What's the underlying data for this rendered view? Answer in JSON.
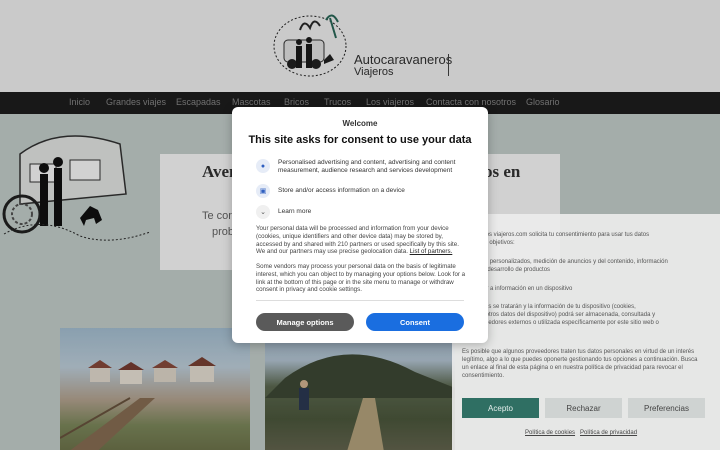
{
  "site": {
    "name": "Autocaravaneros",
    "tagline": "Viajeros"
  },
  "nav": {
    "items": [
      "Inicio",
      "Grandes viajes",
      "Escapadas",
      "Mascotas",
      "Bricos",
      "Trucos",
      "Los viajeros",
      "Contacta con nosotros",
      "Glosario"
    ]
  },
  "hero": {
    "title_start": "Aven",
    "title_end": "os en",
    "text_line1": "Te con",
    "text_line2": "prob"
  },
  "consent_dialog": {
    "welcome": "Welcome",
    "title": "This site asks for consent to use your data",
    "purposes": [
      "Personalised advertising and content, advertising and content measurement, audience research and services development",
      "Store and/or access information on a device",
      "Learn more"
    ],
    "paragraph1": "Your personal data will be processed and information from your device (cookies, unique identifiers and other device data) may be stored by, accessed by and shared with 210 partners or used specifically by this site. We and our partners may use precise geolocation data.",
    "partners_link": "List of partners.",
    "paragraph2": "Some vendors may process your personal data on the basis of legitimate interest, which you can object to by managing your options below. Look for a link at the bottom of this page or in the site menu to manage or withdraw consent in privacy and cookie settings.",
    "manage_button": "Manage options",
    "consent_button": "Consent",
    "accent_color": "#1a6ee0"
  },
  "cookie_panel": {
    "lines": [
      "aravaneros viajeros.com solicita tu consentimiento para usar tus datos",
      "con estos objetivos:",
      "contenido personalizados, medición de anuncios y del contenido, información",
      "público y desarrollo de productos",
      "o acceder a información en un dispositivo",
      "personales se tratarán y la información de tu dispositivo (cookies,",
      "únicos y otros datos del dispositivo) podrá ser almacenada, consultada y",
      "con proveedores externos o utilizada específicamente por este sitio web o",
      "",
      "Es posible que algunos proveedores traten tus datos personales en virtud de un interés",
      "legítimo, algo a lo que puedes oponerte gestionando tus opciones a continuación. Busca",
      "un enlace al final de esta página o en nuestra política de privacidad para revocar el",
      "consentimiento."
    ],
    "accept_button": "Acepto",
    "reject_button": "Rechazar",
    "prefs_button": "Preferencias",
    "cookie_policy_link": "Política de cookies",
    "privacy_policy_link": "Política de privacidad"
  }
}
